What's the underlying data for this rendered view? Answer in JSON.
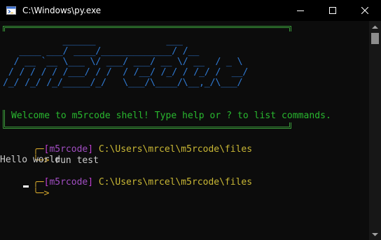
{
  "window": {
    "title": "C:\\Windows\\py.exe",
    "icon": "python-console-icon"
  },
  "banner": {
    "ascii_lines": [
      "           ______             ___ ",
      "   ____ ___/ ____/_____________/ /__ ",
      "  / __ `__ \\___ \\/ ___/ ___/ __ \\/ __  / _ \\",
      " / / / / / /___/ / /  / /__/ /_/ / /_/ /  __/",
      "/_/ /_/ /_/_____/_/   \\___/\\____/\\__,_/\\___/ "
    ],
    "welcome": "Welcome to m5rcode shell! Type help or ? to list commands."
  },
  "prompt1": {
    "bracket_open": "[",
    "app": "m5rcode",
    "bracket_close": "]",
    "path": " C:\\Users\\mrcel\\m5rcode\\files",
    "arrow": "╰─> ",
    "command": "run test"
  },
  "output": {
    "line1": "Hello world"
  },
  "prompt2": {
    "bracket_open": "[",
    "app": "m5rcode",
    "bracket_close": "]",
    "path": " C:\\Users\\mrcel\\m5rcode\\files",
    "arrow": "╰─> "
  },
  "colors": {
    "background": "#0c0c0c",
    "ascii_blue": "#2f78d0",
    "welcome_green": "#29b82f",
    "border_green": "#3a9a3a",
    "prompt_corner": "#d4a72c",
    "prompt_bracket": "#c23fd3",
    "path_yellow": "#c9b735"
  }
}
